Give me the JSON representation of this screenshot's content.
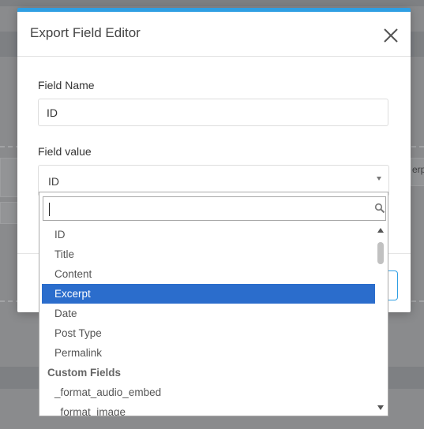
{
  "background": {
    "side_text": "erpt"
  },
  "modal": {
    "title": "Export Field Editor",
    "accent_color": "#2f9fe3",
    "close_icon": "close-icon",
    "field_name": {
      "label": "Field Name",
      "value": "ID"
    },
    "field_value": {
      "label": "Field value",
      "selected": "ID"
    }
  },
  "dropdown": {
    "search": {
      "value": "",
      "icon": "search-icon"
    },
    "highlight_color": "#2b6dcc",
    "options": [
      {
        "label": "ID",
        "type": "option"
      },
      {
        "label": "Title",
        "type": "option"
      },
      {
        "label": "Content",
        "type": "option"
      },
      {
        "label": "Excerpt",
        "type": "option",
        "highlighted": true
      },
      {
        "label": "Date",
        "type": "option"
      },
      {
        "label": "Post Type",
        "type": "option"
      },
      {
        "label": "Permalink",
        "type": "option"
      },
      {
        "label": "Custom Fields",
        "type": "group"
      },
      {
        "label": "_format_audio_embed",
        "type": "option"
      },
      {
        "label": "_format_image",
        "type": "option"
      }
    ]
  }
}
